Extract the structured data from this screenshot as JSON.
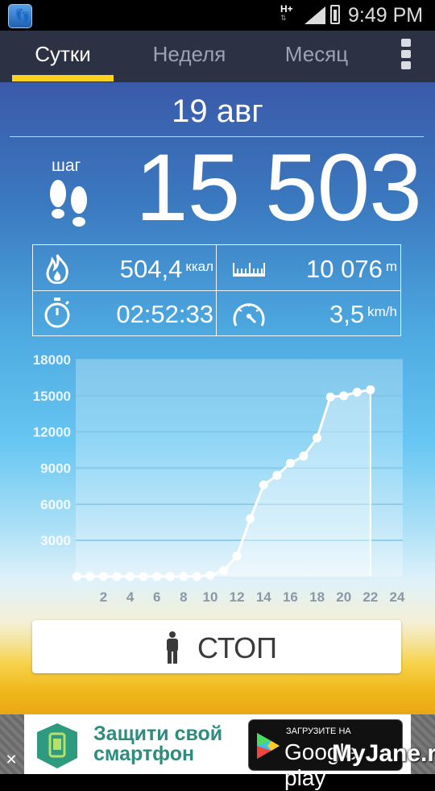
{
  "status_bar": {
    "network": "H+",
    "network_arrows": "⇅",
    "time": "9:49 PM"
  },
  "tabs": [
    {
      "label": "Сутки",
      "active": true
    },
    {
      "label": "Неделя",
      "active": false
    },
    {
      "label": "Месяц",
      "active": false
    }
  ],
  "overflow_menu_icon": "overflow-menu-icon",
  "summary": {
    "date": "19 авг",
    "step_label": "шаг",
    "step_count": "15 503"
  },
  "stats": {
    "calories": {
      "value": "504,4",
      "unit": "ккал",
      "icon": "flame-icon"
    },
    "distance": {
      "value": "10 076",
      "unit": "m",
      "icon": "ruler-icon"
    },
    "duration": {
      "value": "02:52:33",
      "icon": "stopwatch-icon"
    },
    "speed": {
      "value": "3,5",
      "unit": "km/h",
      "icon": "speedometer-icon"
    }
  },
  "chart_data": {
    "type": "area",
    "x": [
      0,
      1,
      2,
      3,
      4,
      5,
      6,
      7,
      8,
      9,
      10,
      11,
      12,
      13,
      14,
      15,
      16,
      17,
      18,
      19,
      20,
      21,
      22
    ],
    "values": [
      0,
      0,
      0,
      0,
      0,
      0,
      0,
      0,
      0,
      0,
      100,
      500,
      1700,
      4800,
      7600,
      8400,
      9400,
      10000,
      11500,
      14900,
      15000,
      15300,
      15503
    ],
    "x_ticks": [
      2,
      4,
      6,
      8,
      10,
      12,
      14,
      16,
      18,
      20,
      22,
      24
    ],
    "y_ticks": [
      3000,
      6000,
      9000,
      12000,
      15000,
      18000
    ],
    "xlim": [
      -0.5,
      24
    ],
    "ylim": [
      0,
      18000
    ],
    "grid": true,
    "colors": {
      "line": "#ffffff",
      "fill": "#ffffff",
      "grid": "#7fc6e6"
    }
  },
  "stop_button": {
    "label": "СТОП",
    "icon": "person-icon"
  },
  "ad": {
    "line1": "Защити свой",
    "line2": "смартфон",
    "badge_small": "ЗАГРУЗИТЕ НА",
    "badge_big": "Google play",
    "close": "✕"
  },
  "watermark": "MyJane.ru"
}
